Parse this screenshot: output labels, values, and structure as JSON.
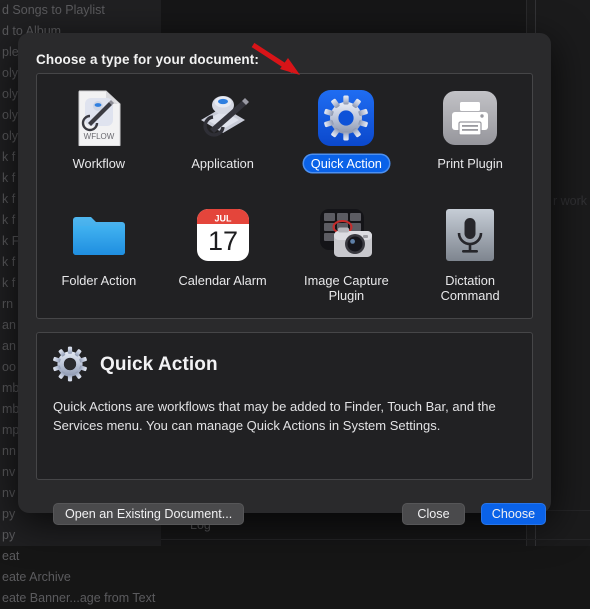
{
  "background": {
    "list_items": [
      "d Songs to Playlist",
      "d to Album",
      "ple",
      "oly",
      "oly",
      "oly",
      "oly",
      "k f",
      "k f",
      "k f",
      "k f",
      "k F",
      "k f",
      "k f",
      "rn",
      "an",
      "an",
      "oo",
      "mb",
      "mb",
      "mp",
      "nn",
      "nv",
      "nv",
      "py",
      "py",
      "eat",
      "eate Archive",
      "eate Banner...age from Text"
    ],
    "faint_hint": "r work",
    "log_label": "Log"
  },
  "dialog": {
    "title": "Choose a type for your document:",
    "types": [
      {
        "label": "Workflow",
        "icon": "workflow-document-icon",
        "selected": false
      },
      {
        "label": "Application",
        "icon": "automator-robot-icon",
        "selected": false
      },
      {
        "label": "Quick Action",
        "icon": "quick-action-gear-icon",
        "selected": true
      },
      {
        "label": "Print Plugin",
        "icon": "printer-icon",
        "selected": false
      },
      {
        "label": "Folder Action",
        "icon": "blue-folder-icon",
        "selected": false
      },
      {
        "label": "Calendar Alarm",
        "icon": "calendar-icon",
        "selected": false
      },
      {
        "label": "Image Capture\nPlugin",
        "icon": "image-capture-camera-icon",
        "selected": false
      },
      {
        "label": "Dictation\nCommand",
        "icon": "microphone-icon",
        "selected": false
      }
    ],
    "calendar_icon": {
      "month": "JUL",
      "day": "17"
    },
    "workflow_icon_badge": "WFLOW",
    "description": {
      "title": "Quick Action",
      "body": "Quick Actions are workflows that may be added to Finder, Touch Bar, and the Services menu. You can manage Quick Actions in System Settings."
    },
    "buttons": {
      "open_existing": "Open an Existing Document...",
      "close": "Close",
      "choose": "Choose"
    }
  },
  "annotation": {
    "arrow_color": "#d81418",
    "points_to": "Quick Action"
  },
  "colors": {
    "accent_blue": "#0a62e8",
    "sheet_bg": "#2a2a2c",
    "panel_bg": "#212123",
    "arrow_red": "#d81418"
  }
}
